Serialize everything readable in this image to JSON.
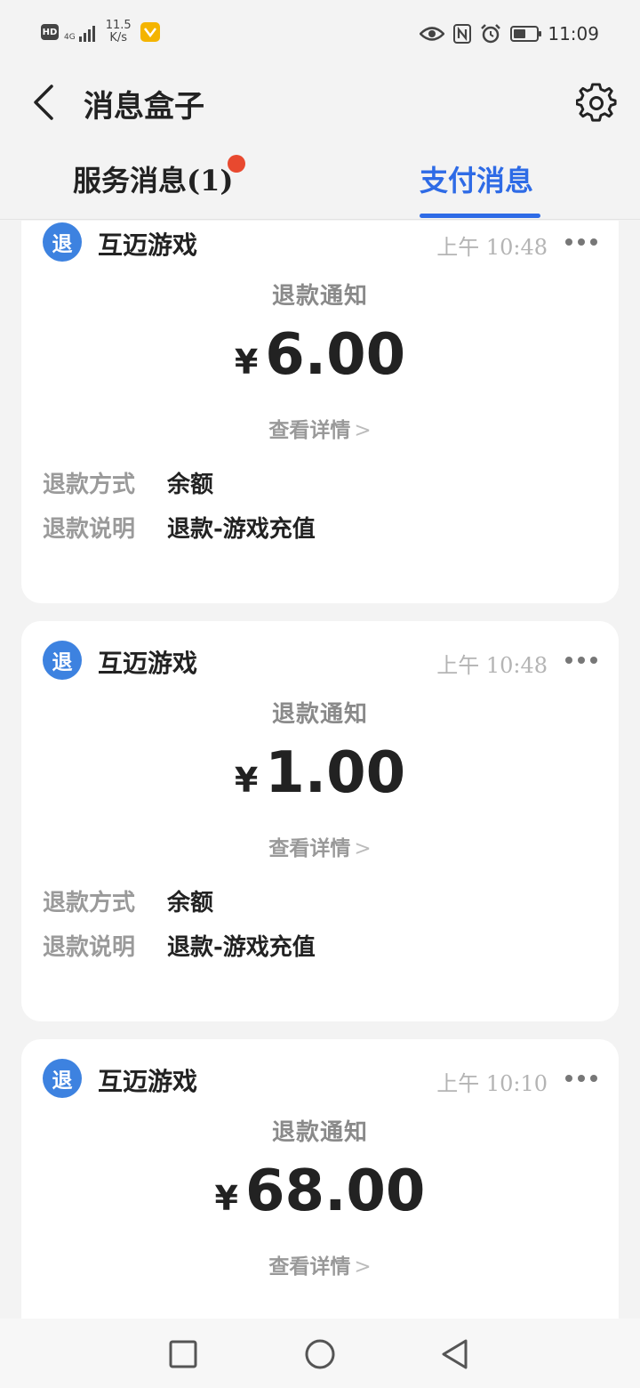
{
  "status_bar": {
    "hd": "HD",
    "network": "4G",
    "speed_value": "11.5",
    "speed_unit": "K/s",
    "battery_level": 0.55,
    "time": "11:09",
    "icons": [
      "eye-icon",
      "nfc-icon",
      "alarm-icon",
      "battery-icon"
    ]
  },
  "header": {
    "title": "消息盒子",
    "back_icon": "chevron-left-icon",
    "settings_icon": "gear-icon"
  },
  "tabs": [
    {
      "label": "服务消息(1)",
      "active": false,
      "has_badge": true
    },
    {
      "label": "支付消息",
      "active": true
    }
  ],
  "colors": {
    "accent": "#2e6be6",
    "badge": "#e8492f",
    "refund_icon": "#3d82e0"
  },
  "messages": [
    {
      "icon_char": "退",
      "merchant": "互迈游戏",
      "time": "上午 10:48",
      "title": "退款通知",
      "currency": "¥",
      "amount": "6.00",
      "detail_link": "查看详情",
      "rows": [
        {
          "label": "退款方式",
          "value": "余额"
        },
        {
          "label": "退款说明",
          "value": "退款-游戏充值"
        }
      ]
    },
    {
      "icon_char": "退",
      "merchant": "互迈游戏",
      "time": "上午 10:48",
      "title": "退款通知",
      "currency": "¥",
      "amount": "1.00",
      "detail_link": "查看详情",
      "rows": [
        {
          "label": "退款方式",
          "value": "余额"
        },
        {
          "label": "退款说明",
          "value": "退款-游戏充值"
        }
      ]
    },
    {
      "icon_char": "退",
      "merchant": "互迈游戏",
      "time": "上午 10:10",
      "title": "退款通知",
      "currency": "¥",
      "amount": "68.00",
      "detail_link": "查看详情"
    }
  ],
  "nav_bar": [
    "recents-square-icon",
    "home-circle-icon",
    "back-triangle-icon"
  ]
}
